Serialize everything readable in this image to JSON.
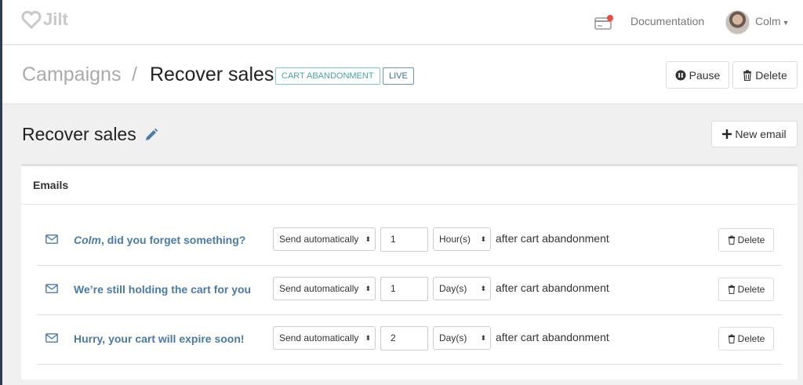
{
  "app": {
    "logo_text": "Jilt"
  },
  "nav": {
    "documentation": "Documentation",
    "user_name": "Colm"
  },
  "header": {
    "breadcrumb_root": "Campaigns",
    "separator": "/",
    "title": "Recover sales",
    "tags": [
      "CART ABANDONMENT",
      "LIVE"
    ],
    "pause_label": "Pause",
    "delete_label": "Delete"
  },
  "section": {
    "title": "Recover sales",
    "new_email_label": "New email"
  },
  "emails_panel": {
    "title": "Emails",
    "rows": [
      {
        "subject_first": "Colm",
        "subject_rest": ", did you forget something?",
        "send_mode": "Send automatically",
        "delay_value": "1",
        "delay_unit": "Hour(s)",
        "trigger_text": "after cart abandonment",
        "delete_label": "Delete"
      },
      {
        "subject_first": "",
        "subject_rest": "We’re still holding the cart for you",
        "send_mode": "Send automatically",
        "delay_value": "1",
        "delay_unit": "Day(s)",
        "trigger_text": "after cart abandonment",
        "delete_label": "Delete"
      },
      {
        "subject_first": "",
        "subject_rest": "Hurry, your cart will expire soon!",
        "send_mode": "Send automatically",
        "delay_value": "2",
        "delay_unit": "Day(s)",
        "trigger_text": "after cart abandonment",
        "delete_label": "Delete"
      }
    ]
  },
  "colors": {
    "accent_link": "#4a7aa8",
    "tag_cart": "#4aa3a0",
    "tag_live": "#3c6c95",
    "notification_dot": "#e74c3c"
  },
  "icons": [
    "heart-logo-icon",
    "credit-card-icon",
    "pause-icon",
    "trash-icon",
    "pencil-icon",
    "plus-icon",
    "envelope-icon",
    "select-arrows-icon"
  ]
}
